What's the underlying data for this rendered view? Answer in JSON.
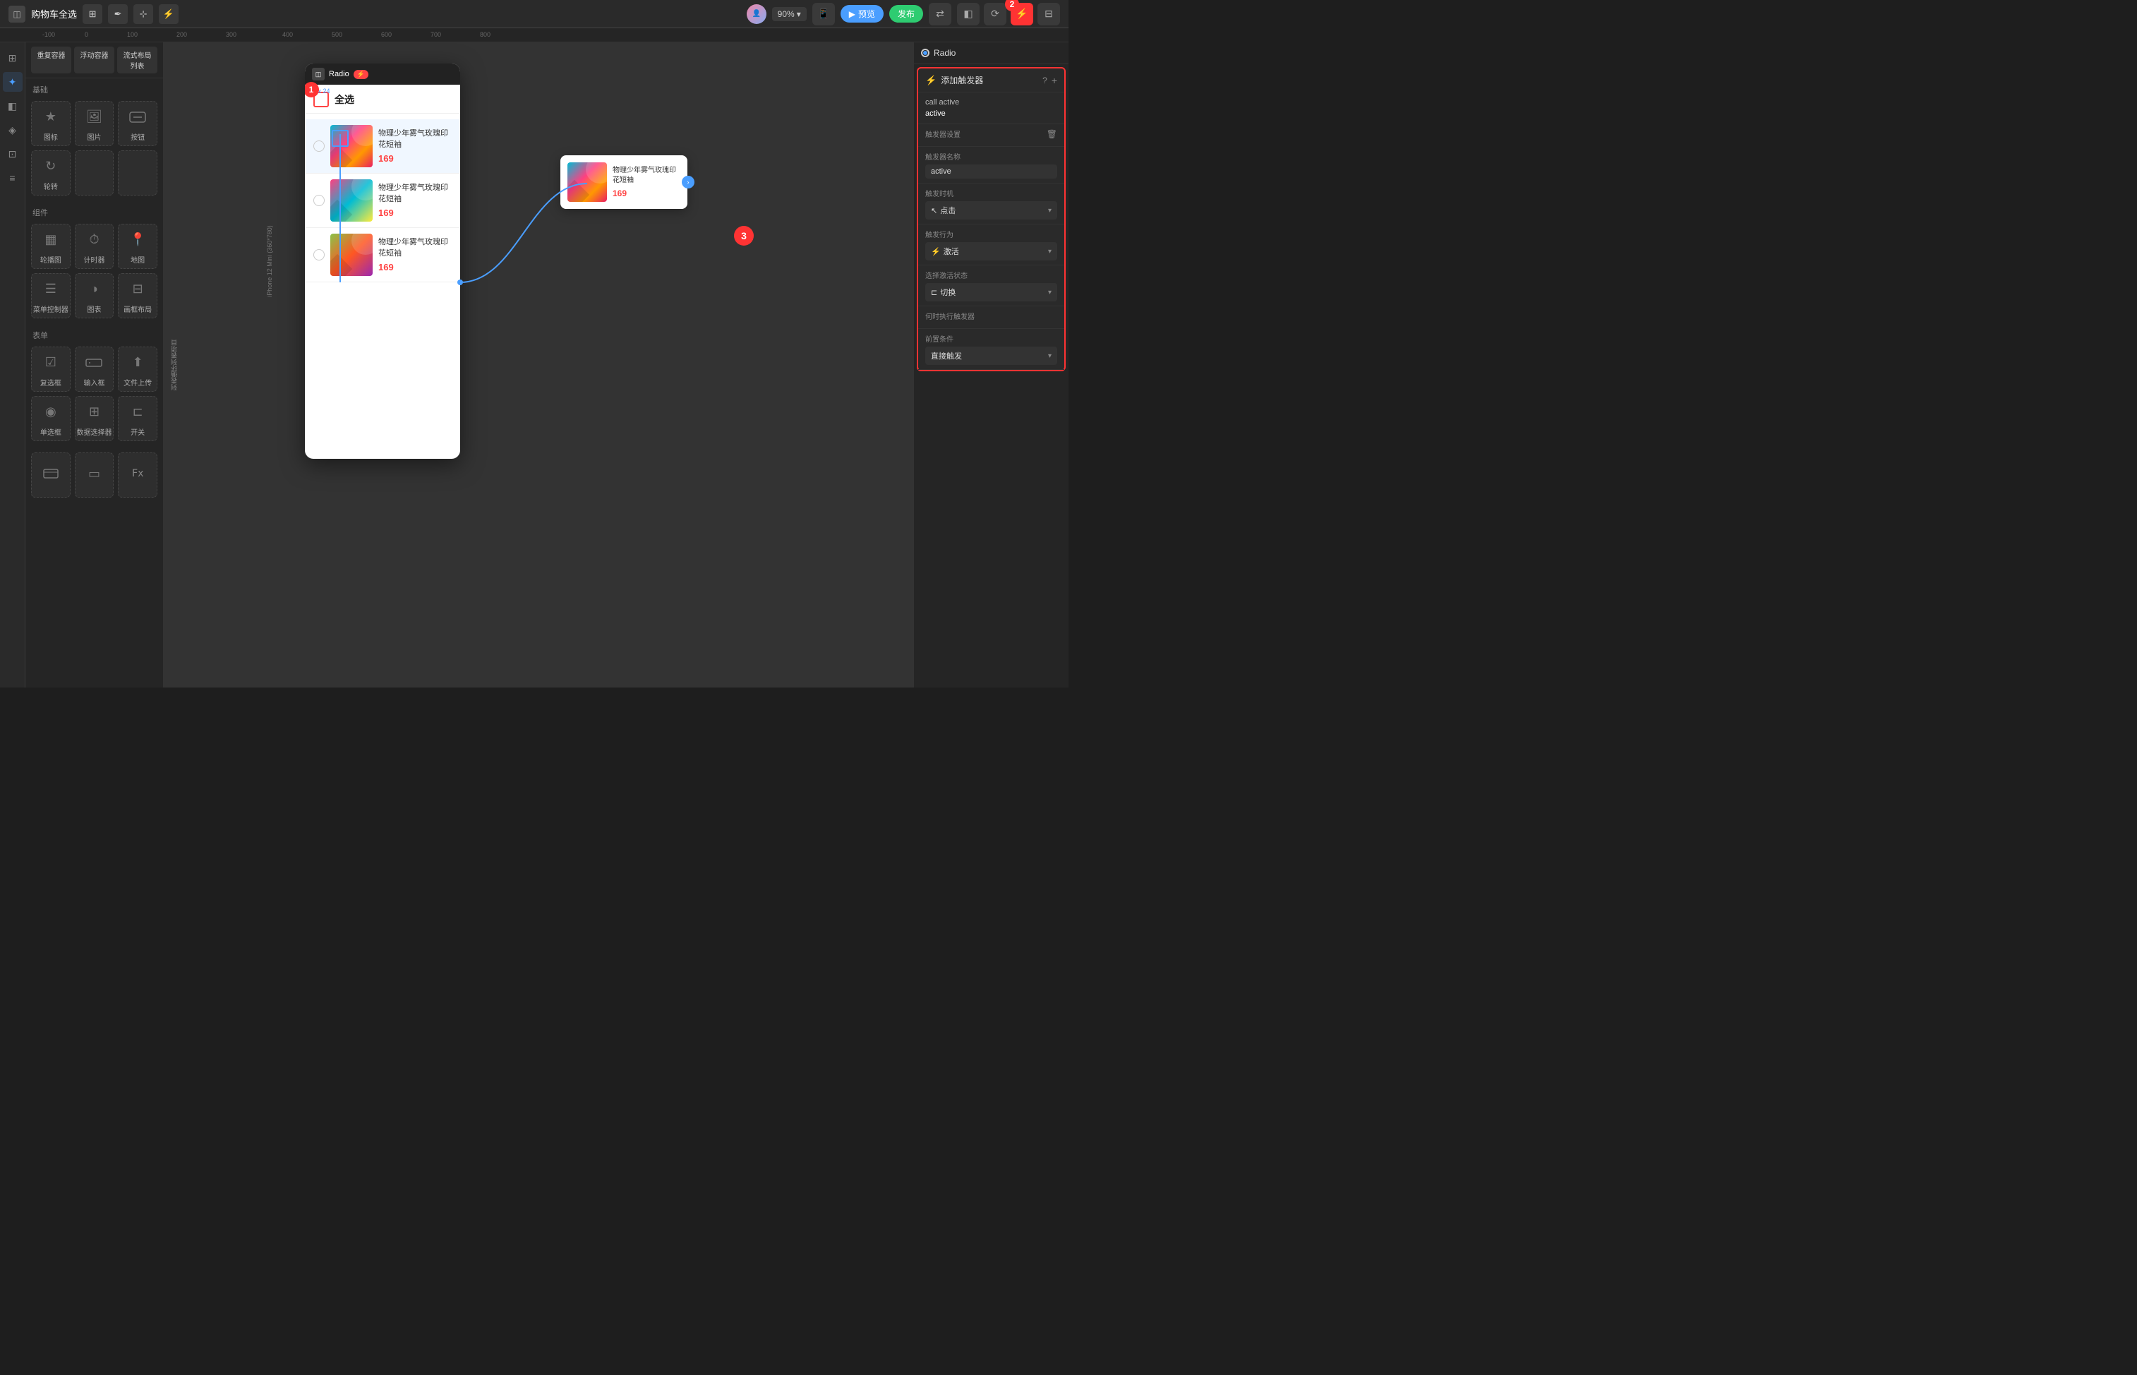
{
  "topbar": {
    "title": "购物车全选",
    "zoom": "90%",
    "btn_preview": "预览",
    "btn_publish": "发布",
    "icon_layout": "◫",
    "icon_pen": "✏",
    "icon_cursor": "⌖",
    "icon_bolt": "⚡"
  },
  "ruler": {
    "ticks": [
      "-100",
      "0",
      "100",
      "200",
      "300",
      "400",
      "500",
      "600",
      "700",
      "800"
    ]
  },
  "left_icons": [
    "⊞",
    "✦",
    "◧",
    "◈",
    "⊡",
    "≡"
  ],
  "components": {
    "top_items": [
      "重复容器",
      "浮动容器",
      "流式布局列表"
    ],
    "sections": [
      {
        "title": "基础",
        "items": [
          {
            "name": "图标",
            "icon": "★"
          },
          {
            "name": "图片",
            "icon": "🖼"
          },
          {
            "name": "按钮",
            "icon": "⊡"
          },
          {
            "name": "轮转",
            "icon": "↻"
          },
          {
            "name": "",
            "icon": ""
          },
          {
            "name": "",
            "icon": ""
          }
        ]
      },
      {
        "title": "组件",
        "items": [
          {
            "name": "轮播图",
            "icon": "▦"
          },
          {
            "name": "计时器",
            "icon": "⊙"
          },
          {
            "name": "地图",
            "icon": "📍"
          },
          {
            "name": "菜单控制器",
            "icon": "☰"
          },
          {
            "name": "图表",
            "icon": "◑"
          },
          {
            "name": "画框布局",
            "icon": "⊟"
          }
        ]
      },
      {
        "title": "表单",
        "items": [
          {
            "name": "复选框",
            "icon": "☑"
          },
          {
            "name": "输入框",
            "icon": "▭"
          },
          {
            "name": "文件上传",
            "icon": "⬆"
          },
          {
            "name": "单选框",
            "icon": "◉"
          },
          {
            "name": "数据选择器",
            "icon": "⊞"
          },
          {
            "name": "开关",
            "icon": "⊏"
          }
        ]
      },
      {
        "title": "",
        "items": [
          {
            "name": "",
            "icon": "⊟"
          },
          {
            "name": "",
            "icon": "▭"
          },
          {
            "name": "",
            "icon": "Fx"
          }
        ]
      }
    ]
  },
  "right_panel": {
    "radio_label": "Radio",
    "trigger_panel": {
      "header_label": "添加触发器",
      "event_tags": [
        "call active",
        "active"
      ],
      "settings_title": "触发器设置",
      "name_label": "触发器名称",
      "name_value": "active",
      "timing_label": "触发时机",
      "timing_value": "点击",
      "behavior_label": "触发行为",
      "behavior_value": "激活",
      "behavior_icon": "⚡",
      "activate_state_label": "选择激活状态",
      "activate_state_value": "切换",
      "when_label": "何时执行触发器",
      "precondition_label": "前置条件",
      "precondition_value": "直接触发"
    }
  },
  "canvas": {
    "phone_label": "iPhone 12 Mini (360*780)",
    "phone_header": "全选",
    "product_name": "物理少年雾气玫瑰印花短袖",
    "product_price": "169",
    "nav_label": "列表循环列表项目",
    "card": {
      "name": "物理少年雾气玫瑰印花短袖",
      "price": "169"
    }
  },
  "annotations": {
    "num1": "1",
    "num2": "2",
    "num3": "3"
  },
  "icons": {
    "bolt": "⚡",
    "chevron_down": "▾",
    "chevron_right": "›",
    "delete": "🗑",
    "help": "?",
    "plus": "+",
    "toggle": "⊏",
    "cursor": "↖"
  }
}
